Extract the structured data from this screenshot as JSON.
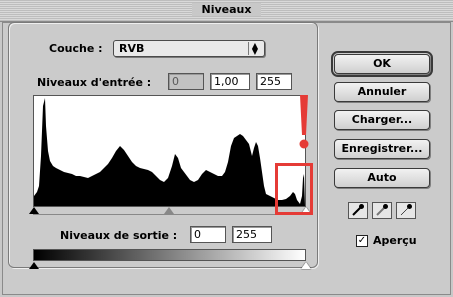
{
  "window": {
    "title": "Niveaux"
  },
  "channel": {
    "label": "Couche :",
    "value": "RVB"
  },
  "input_levels": {
    "label": "Niveaux d'entrée :",
    "black": "0",
    "gamma": "1,00",
    "white": "255"
  },
  "output_levels": {
    "label": "Niveaux de sortie :",
    "black": "0",
    "white": "255"
  },
  "buttons": {
    "ok": "OK",
    "cancel": "Annuler",
    "load": "Charger...",
    "save": "Enregistrer...",
    "auto": "Auto"
  },
  "preview": {
    "label": "Aperçu",
    "checked": true
  },
  "annotation": {
    "color": "#e53b36",
    "mark": "!"
  },
  "icons": {
    "popup_arrows": "up-down-arrows-icon",
    "eyedroppers": [
      "black-eyedropper-icon",
      "gray-eyedropper-icon",
      "white-eyedropper-icon"
    ]
  }
}
